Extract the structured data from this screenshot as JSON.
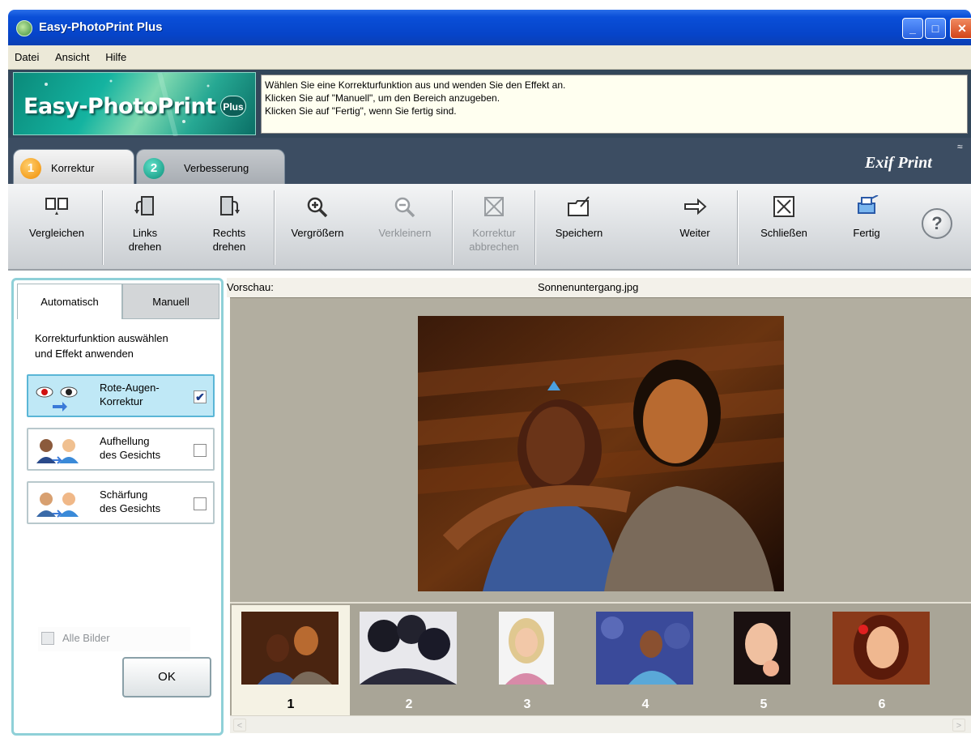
{
  "window": {
    "title": "Easy-PhotoPrint Plus",
    "buttons": {
      "minimize": "_",
      "maximize": "□",
      "close": "✕"
    }
  },
  "menu": [
    "Datei",
    "Ansicht",
    "Hilfe"
  ],
  "banner": {
    "logo": "Easy-PhotoPrint",
    "logo_plus": "Plus",
    "lines": [
      "Wählen Sie eine Korrekturfunktion aus und wenden Sie den Effekt an.",
      "Klicken Sie auf \"Manuell\", um den Bereich anzugeben.",
      "Klicken Sie auf \"Fertig\", wenn Sie fertig sind."
    ]
  },
  "tabs": [
    {
      "num": "1",
      "label": "Korrektur"
    },
    {
      "num": "2",
      "label": "Verbesserung"
    }
  ],
  "brand": "Exif Print",
  "toolbar": {
    "compare": [
      "Vergleichen"
    ],
    "rotate_left": [
      "Links",
      "drehen"
    ],
    "rotate_right": [
      "Rechts",
      "drehen"
    ],
    "zoom_in": [
      "Vergrößern"
    ],
    "zoom_out": [
      "Verkleinern"
    ],
    "cancel_correction": [
      "Korrektur",
      "abbrechen"
    ],
    "save": [
      "Speichern"
    ],
    "next": [
      "Weiter"
    ],
    "close": [
      "Schließen"
    ],
    "done": [
      "Fertig"
    ],
    "help": "?"
  },
  "panel": {
    "tab_auto": "Automatisch",
    "tab_manual": "Manuell",
    "instruction": [
      "Korrekturfunktion auswählen",
      "und Effekt anwenden"
    ],
    "items": [
      {
        "label": [
          "Rote-Augen-",
          "Korrektur"
        ],
        "checked": true
      },
      {
        "label": [
          "Aufhellung",
          "des Gesichts"
        ],
        "checked": false
      },
      {
        "label": [
          "Schärfung",
          "des Gesichts"
        ],
        "checked": false
      }
    ],
    "all_images": "Alle Bilder",
    "ok": "OK"
  },
  "preview": {
    "label": "Vorschau:",
    "filename": "Sonnenuntergang.jpg"
  },
  "thumbnails": [
    "1",
    "2",
    "3",
    "4",
    "5",
    "6"
  ],
  "check_mark": "✔"
}
